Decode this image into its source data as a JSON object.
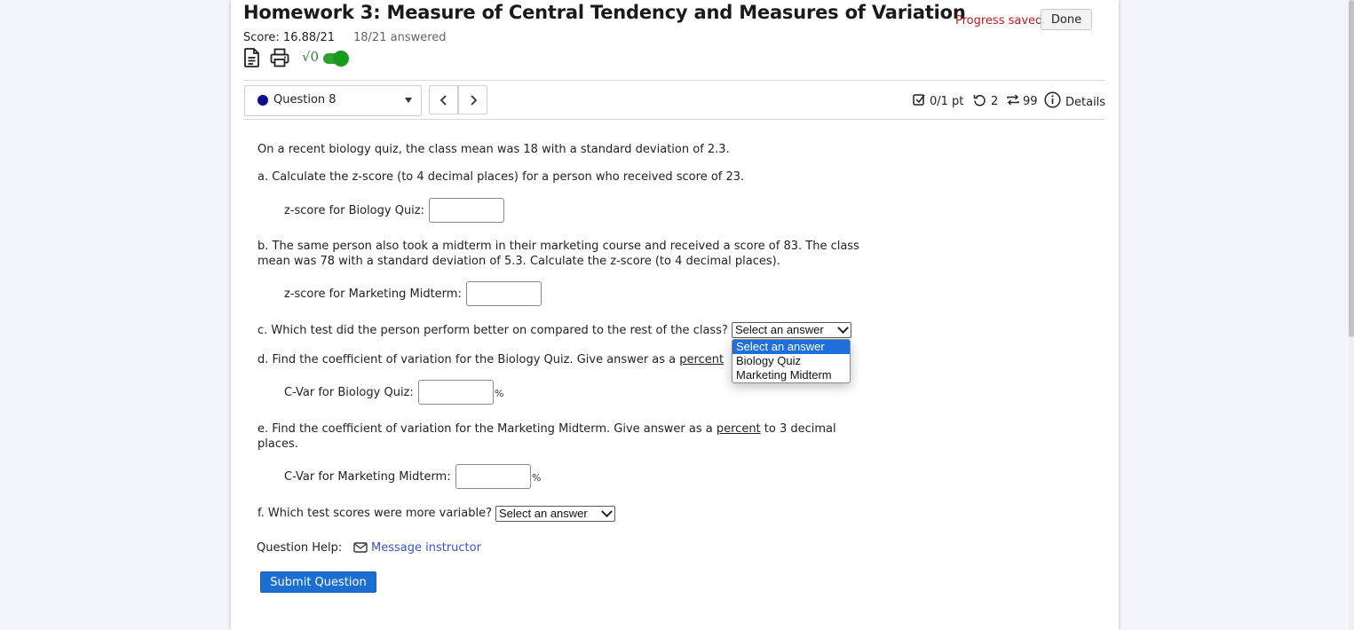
{
  "header": {
    "title": "Homework 3: Measure of Central Tendency and Measures of Variation",
    "score": "Score: 16.88/21",
    "answered": "18/21 answered",
    "progress_saved": "Progress saved",
    "done_label": "Done",
    "tool_icons": [
      "document-icon",
      "print-icon",
      "sqrt-toggle"
    ],
    "sqrt_label": "√0"
  },
  "question_nav": {
    "current": "Question 8",
    "prev_label": "<",
    "next_label": ">"
  },
  "meta": {
    "points": "0/1 pt",
    "retries": "2",
    "attempts": "99",
    "details": "Details"
  },
  "question": {
    "intro": "On a recent biology quiz, the class mean was 18 with a standard deviation of 2.3.",
    "part_a": "a. Calculate the z-score (to 4 decimal places) for a person who received score of 23.",
    "part_a_label": "z-score for Biology Quiz:",
    "part_a_value": "",
    "part_b_line1": "b. The same person also took a midterm in their marketing course and received a score of 83. The class",
    "part_b_line2": "mean was 78 with a standard deviation of 5.3. Calculate the z-score (to 4 decimal places).",
    "part_b_label": "z-score for Marketing Midterm:",
    "part_b_value": "",
    "part_c": "c. Which test did the person perform better on compared to the rest of the class?",
    "part_c_selected": "Select an answer",
    "part_c_options": [
      "Select an answer",
      "Biology Quiz",
      "Marketing Midterm"
    ],
    "part_d_prefix": "d. Find the coefficient of variation for the Biology Quiz. Give answer as a ",
    "part_d_link": "percent",
    "part_d_label": "C-Var for Biology Quiz:",
    "part_d_value": "",
    "pct_symbol": "%",
    "part_e_prefix": "e. Find the coefficient of variation for the Marketing Midterm. Give answer as a ",
    "part_e_link": "percent",
    "part_e_suffix": " to 3 decimal",
    "part_e_line2": "places.",
    "part_e_label": "C-Var for Marketing Midterm:",
    "part_e_value": "",
    "part_f": "f. Which test scores were more variable?",
    "part_f_selected": "Select an answer"
  },
  "help": {
    "label": "Question Help:",
    "message_link": "Message instructor"
  },
  "submit_label": "Submit Question",
  "colors": {
    "accent": "#1a6fd0",
    "progress_saved": "#b71c1c",
    "toggle_green": "#1a9a1a",
    "link": "#3b54c7",
    "selected_option": "#1e6fd9"
  }
}
